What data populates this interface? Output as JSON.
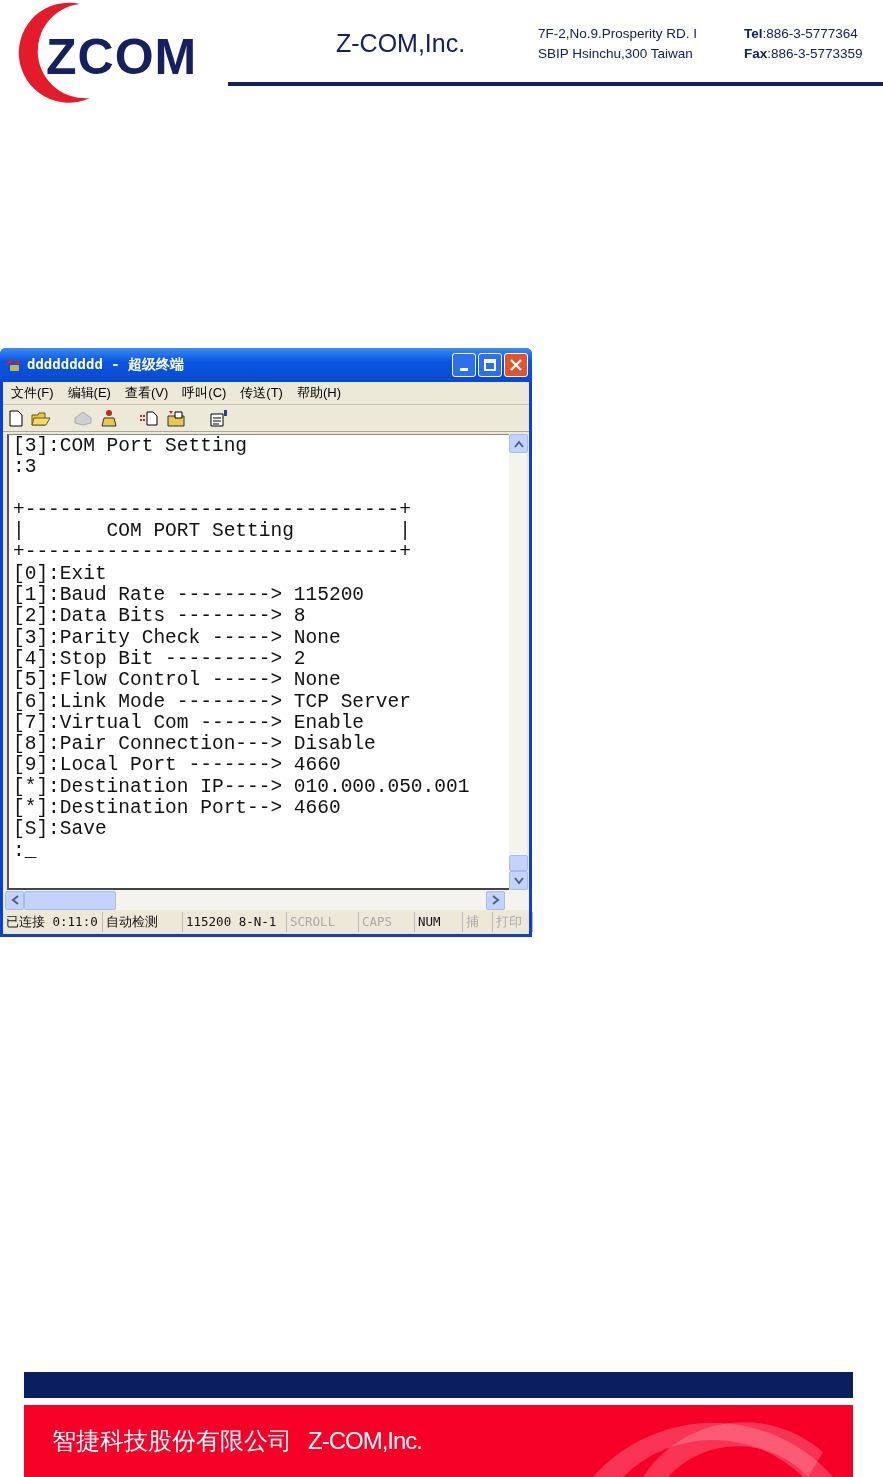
{
  "header": {
    "logo_text": "ZCOM",
    "company": "Z-COM,Inc.",
    "address": [
      "7F-2,No.9.Prosperity RD. I",
      "SBIP Hsinchu,300 Taiwan"
    ],
    "contacts": [
      {
        "label": "Tel",
        "value": ":886-3-5777364"
      },
      {
        "label": "Fax",
        "value": ":886-3-5773359"
      }
    ]
  },
  "window": {
    "title": "ddddddddd - 超级终端",
    "menu": [
      "文件(F)",
      "编辑(E)",
      "查看(V)",
      "呼叫(C)",
      "传送(T)",
      "帮助(H)"
    ],
    "terminal_blocks": [
      [
        "[3]:COM Port Setting",
        ":3"
      ],
      [
        "+--------------------------------+",
        "|       COM PORT Setting         |",
        "+--------------------------------+",
        "[0]:Exit",
        "[1]:Baud Rate --------> 115200",
        "[2]:Data Bits --------> 8",
        "[3]:Parity Check -----> None",
        "[4]:Stop Bit ---------> 2",
        "[5]:Flow Control -----> None",
        "[6]:Link Mode --------> TCP Server",
        "[7]:Virtual Com ------> Enable",
        "[8]:Pair Connection---> Disable",
        "[9]:Local Port -------> 4660",
        "[*]:Destination IP----> 010.000.050.001",
        "[*]:Destination Port--> 4660",
        "[S]:Save",
        ":_"
      ]
    ],
    "status_bar": [
      {
        "text": "已连接 0:11:0",
        "enabled": true
      },
      {
        "text": "自动检测",
        "enabled": true
      },
      {
        "text": "115200 8-N-1",
        "enabled": true
      },
      {
        "text": "SCROLL",
        "enabled": false
      },
      {
        "text": "CAPS",
        "enabled": false
      },
      {
        "text": "NUM",
        "enabled": true
      },
      {
        "text": "捕",
        "enabled": false
      },
      {
        "text": "打印",
        "enabled": false
      }
    ]
  },
  "footer": {
    "company_cn": "智捷科技股份有限公司",
    "company_en": "Z-COM,Inc."
  }
}
